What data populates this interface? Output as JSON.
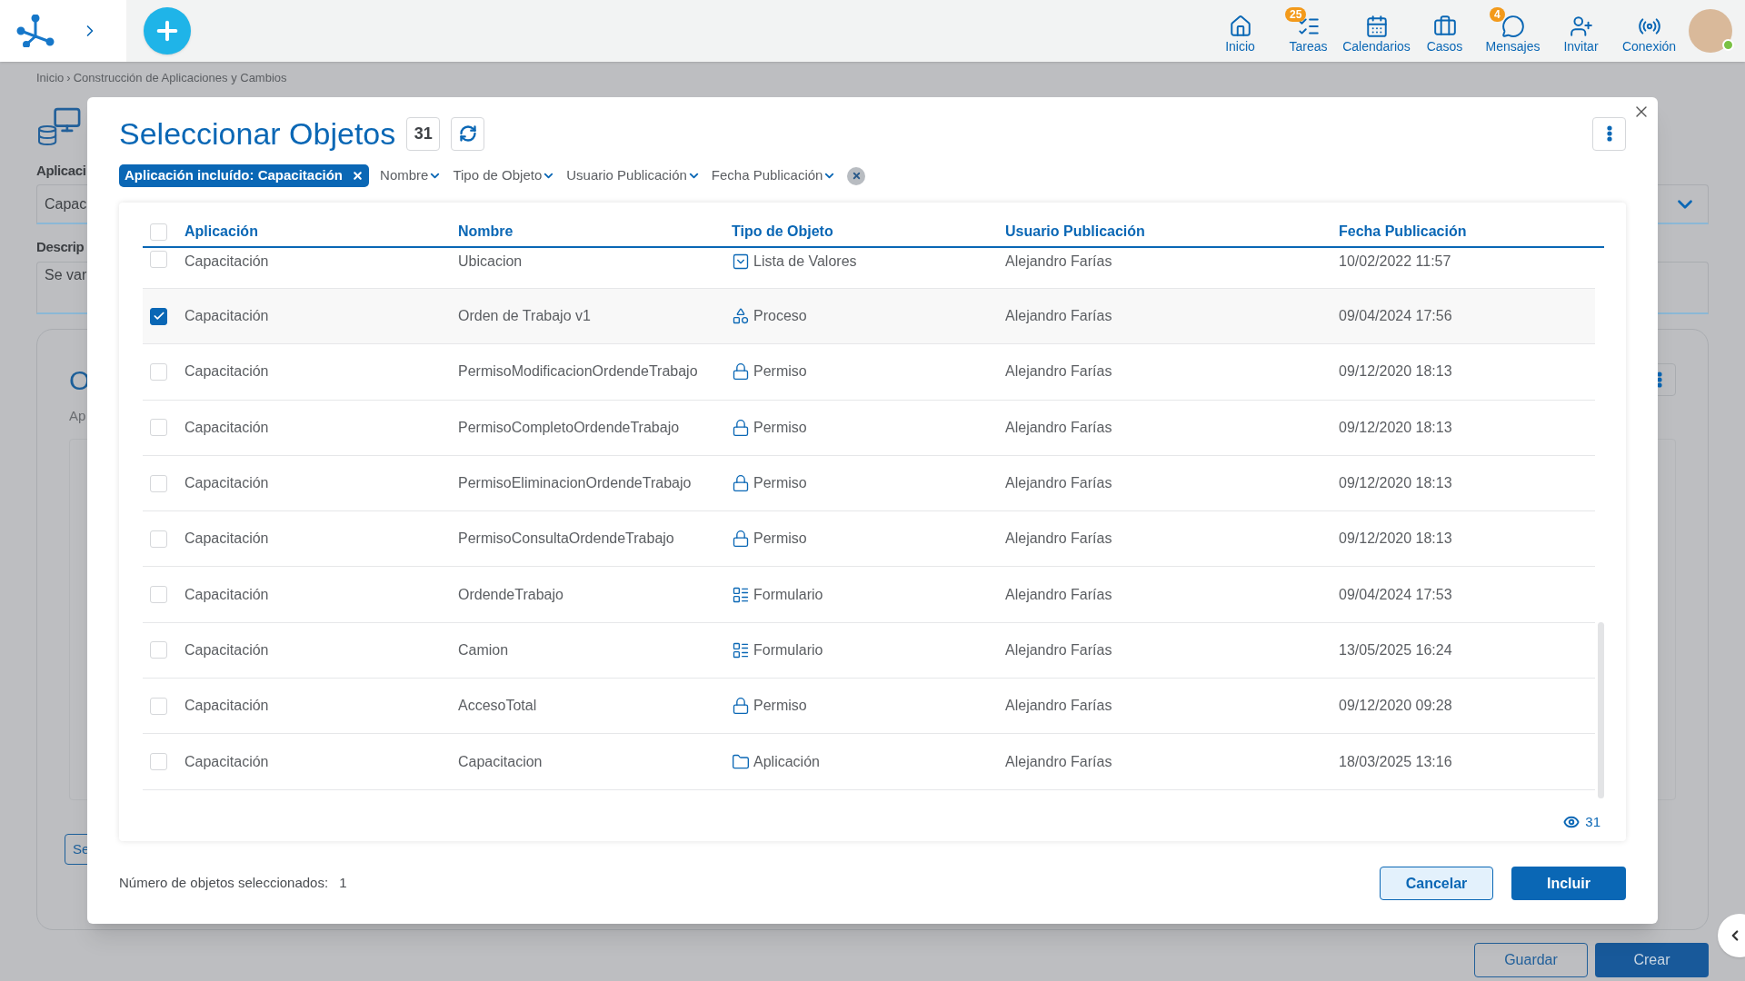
{
  "topbar": {
    "nav": [
      {
        "label": "Inicio",
        "kind": "home"
      },
      {
        "label": "Tareas",
        "kind": "tasks",
        "badge": "25"
      },
      {
        "label": "Calendarios",
        "kind": "calendar"
      },
      {
        "label": "Casos",
        "kind": "cases"
      },
      {
        "label": "Mensajes",
        "kind": "messages",
        "badge": "4"
      },
      {
        "label": "Invitar",
        "kind": "invite"
      },
      {
        "label": "Conexión",
        "kind": "connection"
      }
    ]
  },
  "breadcrumb": [
    "Inicio",
    "Construcción de Aplicaciones y Cambios"
  ],
  "breadcrumb_separator": "›",
  "page": {
    "application_label": "Aplicaci",
    "application_value": "Capac",
    "description_label": "Descrip",
    "description_value": "Se var",
    "section_title": "O",
    "section_subtitle": "Ap",
    "section_button": "Se",
    "buttons": [
      "Guardar",
      "Crear"
    ]
  },
  "dialog": {
    "title": "Seleccionar Objetos",
    "count": "31",
    "filters": [
      {
        "kind": "chip",
        "label": "Aplicación incluído: Capacitación"
      },
      {
        "kind": "dropdown",
        "label": "Nombre"
      },
      {
        "kind": "dropdown",
        "label": "Tipo de Objeto"
      },
      {
        "kind": "dropdown",
        "label": "Usuario Publicación"
      },
      {
        "kind": "dropdown",
        "label": "Fecha Publicación"
      }
    ],
    "table": {
      "select_all": {
        "checked": false
      },
      "columns": [
        "Aplicación",
        "Nombre",
        "Tipo de Objeto",
        "Usuario Publicación",
        "Fecha Publicación"
      ],
      "rows": [
        {
          "checked": false,
          "application": "Capacitación",
          "name": "Ubicacion",
          "type": "Lista de Valores",
          "kind": "list",
          "user": "Alejandro Farías",
          "date": "10/02/2022 11:57"
        },
        {
          "checked": true,
          "application": "Capacitación",
          "name": "Orden de Trabajo v1",
          "type": "Proceso",
          "kind": "process",
          "user": "Alejandro Farías",
          "date": "09/04/2024 17:56"
        },
        {
          "checked": false,
          "application": "Capacitación",
          "name": "PermisoModificacionOrdendeTrabajo",
          "type": "Permiso",
          "kind": "permission",
          "user": "Alejandro Farías",
          "date": "09/12/2020 18:13"
        },
        {
          "checked": false,
          "application": "Capacitación",
          "name": "PermisoCompletoOrdendeTrabajo",
          "type": "Permiso",
          "kind": "permission",
          "user": "Alejandro Farías",
          "date": "09/12/2020 18:13"
        },
        {
          "checked": false,
          "application": "Capacitación",
          "name": "PermisoEliminacionOrdendeTrabajo",
          "type": "Permiso",
          "kind": "permission",
          "user": "Alejandro Farías",
          "date": "09/12/2020 18:13"
        },
        {
          "checked": false,
          "application": "Capacitación",
          "name": "PermisoConsultaOrdendeTrabajo",
          "type": "Permiso",
          "kind": "permission",
          "user": "Alejandro Farías",
          "date": "09/12/2020 18:13"
        },
        {
          "checked": false,
          "application": "Capacitación",
          "name": "OrdendeTrabajo",
          "type": "Formulario",
          "kind": "form",
          "user": "Alejandro Farías",
          "date": "09/04/2024 17:53"
        },
        {
          "checked": false,
          "application": "Capacitación",
          "name": "Camion",
          "type": "Formulario",
          "kind": "form",
          "user": "Alejandro Farías",
          "date": "13/05/2025 16:24"
        },
        {
          "checked": false,
          "application": "Capacitación",
          "name": "AccesoTotal",
          "type": "Permiso",
          "kind": "permission",
          "user": "Alejandro Farías",
          "date": "09/12/2020 09:28"
        },
        {
          "checked": false,
          "application": "Capacitación",
          "name": "Capacitacion",
          "type": "Aplicación",
          "kind": "application",
          "user": "Alejandro Farías",
          "date": "18/03/2025 13:16"
        }
      ],
      "visible_count": "31"
    },
    "selected_label": "Número de objetos seleccionados:",
    "selected_count": "1",
    "buttons": [
      "Cancelar",
      "Incluir"
    ]
  }
}
